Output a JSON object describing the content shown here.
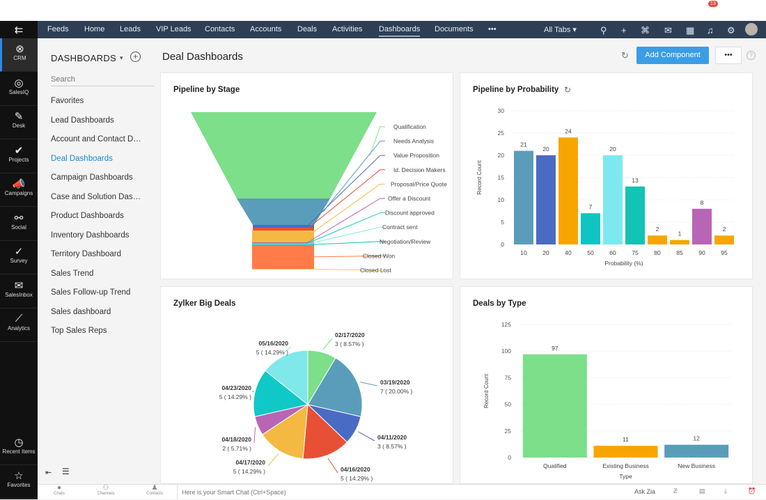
{
  "window": {
    "dots": [
      "#ee5e57",
      "#f5bd2e",
      "#5fc73f"
    ]
  },
  "rail": {
    "items": [
      {
        "label": "CRM",
        "icon": "crm-icon"
      },
      {
        "label": "SalesIQ",
        "icon": "salesiq-icon"
      },
      {
        "label": "Desk",
        "icon": "desk-icon"
      },
      {
        "label": "Projects",
        "icon": "projects-icon"
      },
      {
        "label": "Campaigns",
        "icon": "campaigns-icon"
      },
      {
        "label": "Social",
        "icon": "social-icon"
      },
      {
        "label": "Survey",
        "icon": "survey-icon"
      },
      {
        "label": "SalesInbox",
        "icon": "salesinbox-icon"
      },
      {
        "label": "Analytics",
        "icon": "analytics-icon"
      }
    ],
    "bottom": [
      {
        "label": "Recent Items",
        "icon": "clock-icon"
      },
      {
        "label": "Favorites",
        "icon": "star-icon"
      }
    ]
  },
  "nav": {
    "tabs": [
      "Feeds",
      "Home",
      "Leads",
      "VIP Leads",
      "Contacts",
      "Accounts",
      "Deals",
      "Activities",
      "Dashboards",
      "Documents",
      "•••"
    ],
    "active": "Dashboards",
    "all_tabs": "All Tabs ▾",
    "notification_count": "13"
  },
  "sidebar": {
    "title": "DASHBOARDS",
    "search_placeholder": "Search",
    "items": [
      "Favorites",
      "Lead Dashboards",
      "Account and Contact Dashboards",
      "Deal Dashboards",
      "Campaign Dashboards",
      "Case and Solution Dashboards",
      "Product Dashboards",
      "Inventory Dashboards",
      "Territory Dashboard",
      "Sales Trend",
      "Sales Follow-up Trend",
      "Sales dashboard",
      "Top Sales Reps"
    ],
    "active": "Deal Dashboards"
  },
  "header": {
    "title": "Deal Dashboards",
    "add_component": "Add Component",
    "more": "•••"
  },
  "accent": "#3a9de6",
  "bottombar": {
    "chats": "Chats",
    "channels": "Channels",
    "contacts": "Contacts",
    "chat_placeholder": "Here is your Smart Chat (Ctrl+Space)",
    "ask_zia": "Ask Zia"
  },
  "chart_data": [
    {
      "title": "Pipeline by Stage",
      "type": "funnel",
      "stages": [
        {
          "label": "Qualification",
          "color": "#7ddf8a"
        },
        {
          "label": "Needs Analysis",
          "color": "#5a9dba"
        },
        {
          "label": "Value Proposition",
          "color": "#4a6bc4"
        },
        {
          "label": "Id. Decision Makers",
          "color": "#e85035"
        },
        {
          "label": "Proposal/Price Quote",
          "color": "#f4b942"
        },
        {
          "label": "Offer a Discount",
          "color": "#b865b5"
        },
        {
          "label": "Discount approved",
          "color": "#10c9c6"
        },
        {
          "label": "Contract sent",
          "color": "#7fe8ea"
        },
        {
          "label": "Negotiation/Review",
          "color": "#13c3b4"
        },
        {
          "label": "Closed Won",
          "color": "#ff7b4a"
        },
        {
          "label": "Closed Lost",
          "color": "#f7c948"
        }
      ]
    },
    {
      "title": "Pipeline by Probability",
      "type": "bar",
      "xlabel": "Probability (%)",
      "ylabel": "Record Count",
      "ylim": [
        0,
        30
      ],
      "yticks": [
        0,
        5,
        10,
        15,
        20,
        25,
        30
      ],
      "categories": [
        "10",
        "20",
        "40",
        "50",
        "60",
        "75",
        "80",
        "85",
        "90",
        "95"
      ],
      "values": [
        21,
        20,
        24,
        7,
        20,
        13,
        2,
        1,
        8,
        2
      ],
      "colors": [
        "#5a9dba",
        "#4a6bc4",
        "#f7a600",
        "#11c4c4",
        "#7de9ef",
        "#13c3b4",
        "#f7a600",
        "#f7a600",
        "#b865b5",
        "#f7a600"
      ]
    },
    {
      "title": "Zylker Big Deals",
      "type": "pie",
      "slices": [
        {
          "label": "02/17/2020",
          "value": 3,
          "pct": "3 ( 8.57% )",
          "color": "#7ddf8a"
        },
        {
          "label": "03/19/2020",
          "value": 7,
          "pct": "7 ( 20.00% )",
          "color": "#5a9dba"
        },
        {
          "label": "04/11/2020",
          "value": 3,
          "pct": "3 ( 8.57% )",
          "color": "#4a6bc4"
        },
        {
          "label": "04/16/2020",
          "value": 5,
          "pct": "5 ( 14.29% )",
          "color": "#e85035"
        },
        {
          "label": "04/17/2020",
          "value": 5,
          "pct": "5 ( 14.29% )",
          "color": "#f4b942"
        },
        {
          "label": "04/18/2020",
          "value": 2,
          "pct": "2 ( 5.71% )",
          "color": "#b865b5"
        },
        {
          "label": "04/23/2020",
          "value": 5,
          "pct": "5 ( 14.29% )",
          "color": "#10c9c6"
        },
        {
          "label": "05/16/2020",
          "value": 5,
          "pct": "5 ( 14.29% )",
          "color": "#7fe8ea"
        }
      ]
    },
    {
      "title": "Deals by Type",
      "type": "bar",
      "xlabel": "Type",
      "ylabel": "Record Count",
      "ylim": [
        0,
        125
      ],
      "yticks": [
        0,
        25,
        50,
        75,
        100,
        125
      ],
      "categories": [
        "Qualified",
        "Existing Business",
        "New Business"
      ],
      "values": [
        97,
        11,
        12
      ],
      "colors": [
        "#7ddf8a",
        "#f7a600",
        "#5a9dba"
      ]
    }
  ]
}
